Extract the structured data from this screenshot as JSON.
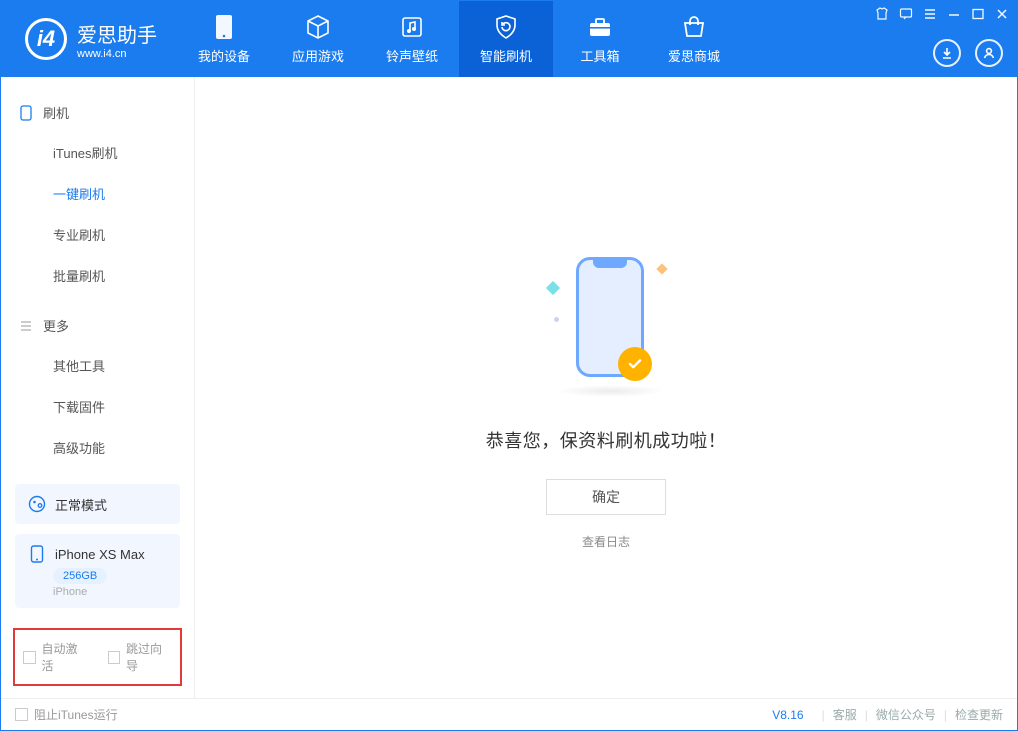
{
  "app": {
    "name_cn": "爱思助手",
    "url": "www.i4.cn"
  },
  "tabs": [
    {
      "label": "我的设备"
    },
    {
      "label": "应用游戏"
    },
    {
      "label": "铃声壁纸"
    },
    {
      "label": "智能刷机"
    },
    {
      "label": "工具箱"
    },
    {
      "label": "爱思商城"
    }
  ],
  "sidebar": {
    "group1": {
      "title": "刷机",
      "items": [
        {
          "label": "iTunes刷机"
        },
        {
          "label": "一键刷机"
        },
        {
          "label": "专业刷机"
        },
        {
          "label": "批量刷机"
        }
      ]
    },
    "group2": {
      "title": "更多",
      "items": [
        {
          "label": "其他工具"
        },
        {
          "label": "下载固件"
        },
        {
          "label": "高级功能"
        }
      ]
    }
  },
  "device": {
    "mode_label": "正常模式",
    "name": "iPhone XS Max",
    "capacity": "256GB",
    "type": "iPhone"
  },
  "options": {
    "auto_activate": "自动激活",
    "skip_wizard": "跳过向导"
  },
  "main": {
    "success_text": "恭喜您，保资料刷机成功啦！",
    "ok_label": "确定",
    "view_log": "查看日志"
  },
  "footer": {
    "block_itunes": "阻止iTunes运行",
    "version": "V8.16",
    "links": [
      "客服",
      "微信公众号",
      "检查更新"
    ]
  }
}
